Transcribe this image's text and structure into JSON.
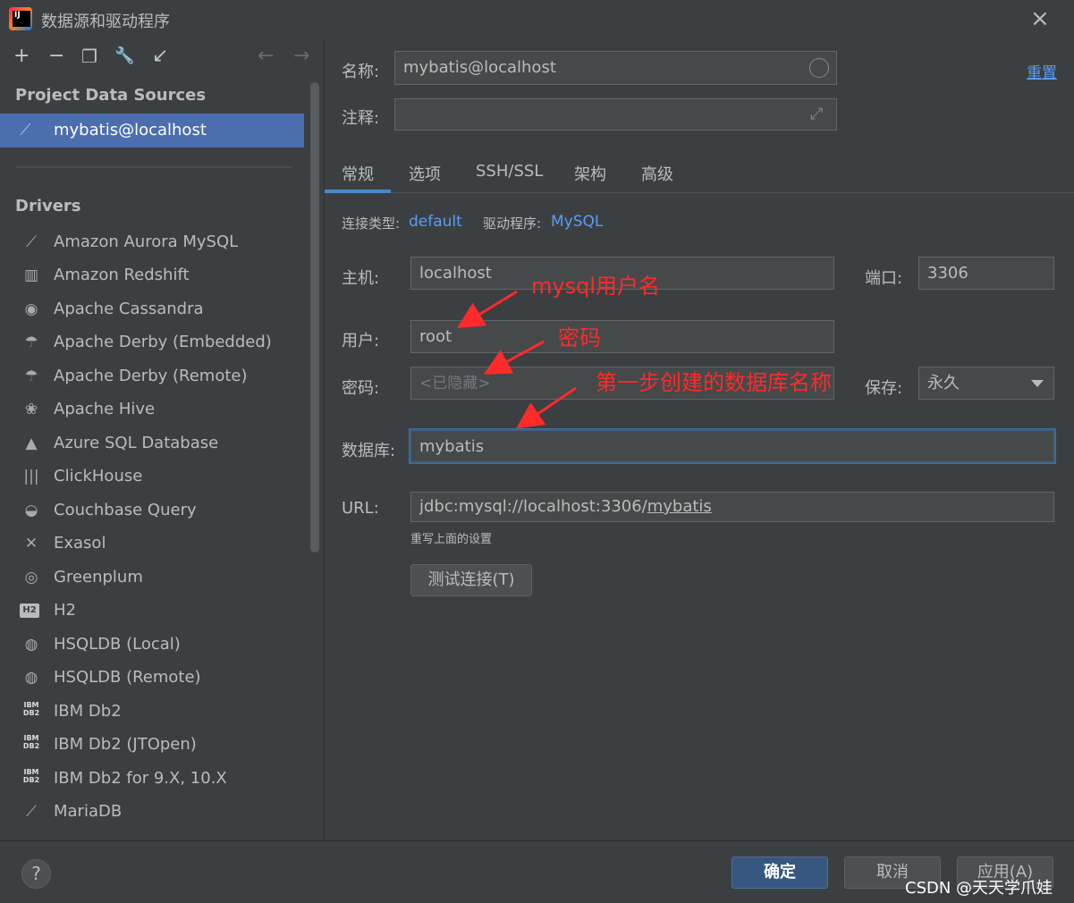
{
  "window": {
    "title": "数据源和驱动程序",
    "close_icon": "×"
  },
  "left": {
    "toolbar": [
      {
        "name": "add-icon",
        "glyph": "+"
      },
      {
        "name": "remove-icon",
        "glyph": "−"
      },
      {
        "name": "copy-icon",
        "glyph": "❐"
      },
      {
        "name": "wrench-icon",
        "glyph": "🔧"
      },
      {
        "name": "import-icon",
        "glyph": "↙"
      },
      {
        "name": "back-icon",
        "glyph": "←"
      },
      {
        "name": "forward-icon",
        "glyph": "→"
      }
    ],
    "project_header": "Project Data Sources",
    "project_item": "mybatis@localhost",
    "drivers_header": "Drivers",
    "drivers": [
      {
        "label": "Amazon Aurora MySQL",
        "icon": "dolphin-icon",
        "glyph": "⟋"
      },
      {
        "label": "Amazon Redshift",
        "icon": "redshift-icon",
        "glyph": "▥"
      },
      {
        "label": "Apache Cassandra",
        "icon": "eye-icon",
        "glyph": "◉"
      },
      {
        "label": "Apache Derby (Embedded)",
        "icon": "derby-hat-icon",
        "glyph": "☂"
      },
      {
        "label": "Apache Derby (Remote)",
        "icon": "derby-hat-icon",
        "glyph": "☂"
      },
      {
        "label": "Apache Hive",
        "icon": "hive-icon",
        "glyph": "❀"
      },
      {
        "label": "Azure SQL Database",
        "icon": "azure-icon",
        "glyph": "▲"
      },
      {
        "label": "ClickHouse",
        "icon": "clickhouse-icon",
        "glyph": "|||"
      },
      {
        "label": "Couchbase Query",
        "icon": "couchbase-icon",
        "glyph": "◒"
      },
      {
        "label": "Exasol",
        "icon": "exasol-icon",
        "glyph": "✕"
      },
      {
        "label": "Greenplum",
        "icon": "greenplum-icon",
        "glyph": "◎"
      },
      {
        "label": "H2",
        "icon": "h2-icon",
        "glyph": "H2"
      },
      {
        "label": "HSQLDB (Local)",
        "icon": "hsqldb-icon",
        "glyph": "◍"
      },
      {
        "label": "HSQLDB (Remote)",
        "icon": "hsqldb-icon",
        "glyph": "◍"
      },
      {
        "label": "IBM Db2",
        "icon": "ibm-db2-icon",
        "glyph": "IBM DB2"
      },
      {
        "label": "IBM Db2 (JTOpen)",
        "icon": "ibm-db2-icon",
        "glyph": "IBM DB2"
      },
      {
        "label": "IBM Db2 for 9.X, 10.X",
        "icon": "ibm-db2-icon",
        "glyph": "IBM DB2"
      },
      {
        "label": "MariaDB",
        "icon": "mariadb-icon",
        "glyph": "⟋"
      }
    ]
  },
  "form": {
    "name_label": "名称:",
    "name_value": "mybatis@localhost",
    "reset_link": "重置",
    "comment_label": "注释:",
    "tabs": [
      "常规",
      "选项",
      "SSH/SSL",
      "架构",
      "高级"
    ],
    "conn_type_label": "连接类型:",
    "conn_type_value": "default",
    "driver_label": "驱动程序:",
    "driver_value": "MySQL",
    "host_label": "主机:",
    "host_value": "localhost",
    "port_label": "端口:",
    "port_value": "3306",
    "user_label": "用户:",
    "user_value": "root",
    "password_label": "密码:",
    "password_placeholder": "<已隐藏>",
    "save_label": "保存:",
    "save_value": "永久",
    "database_label": "数据库:",
    "database_value": "mybatis",
    "url_label": "URL:",
    "url_prefix": "jdbc:mysql://localhost:3306/",
    "url_db": "mybatis",
    "url_hint": "重写上面的设置",
    "test_button": "测试连接(T)"
  },
  "annotations": {
    "user_note": "mysql用户名",
    "password_note": "密码",
    "database_note": "第一步创建的数据库名称",
    "color": "#ff2a2a"
  },
  "footer": {
    "help": "?",
    "ok": "确定",
    "cancel": "取消",
    "apply": "应用(A)",
    "watermark": "CSDN @天天学爪娃"
  },
  "colors": {
    "selection": "#4b6eaf",
    "link": "#589df6",
    "primary_button": "#365880",
    "background": "#3c3f41"
  }
}
